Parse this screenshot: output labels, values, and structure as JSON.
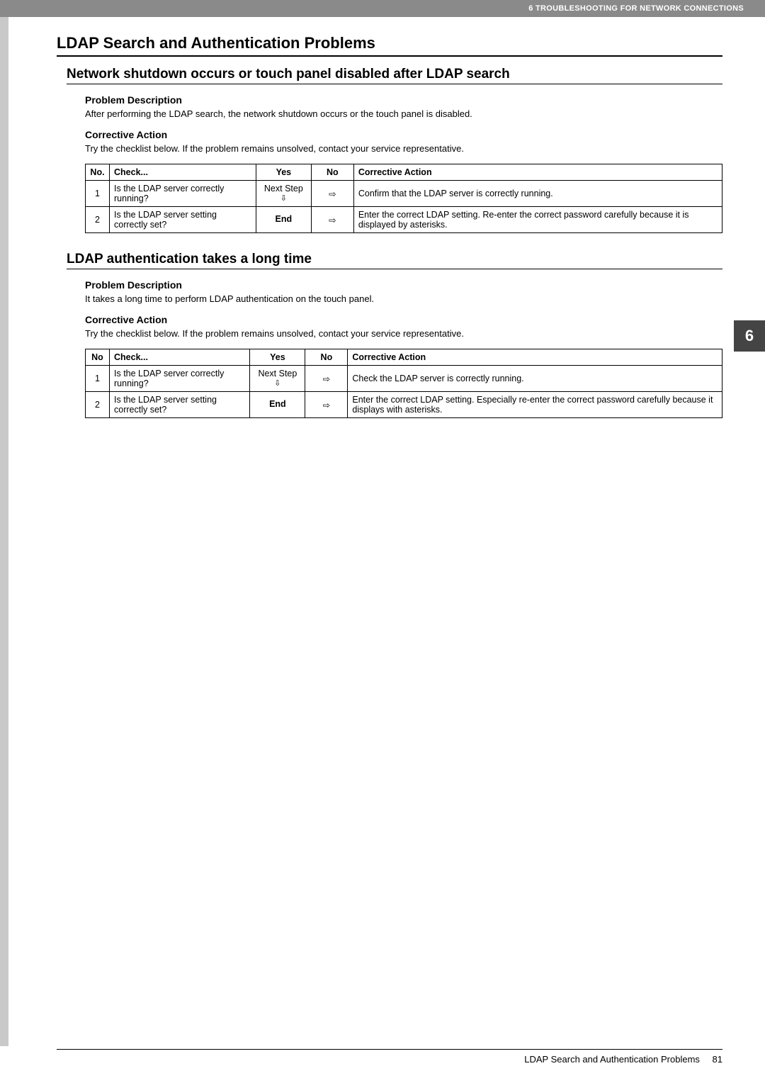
{
  "header": {
    "chapter": "6 TROUBLESHOOTING FOR NETWORK CONNECTIONS"
  },
  "h1": "LDAP Search and Authentication Problems",
  "section1": {
    "title": "Network shutdown occurs or touch panel disabled after LDAP search",
    "problem_h": "Problem Description",
    "problem_t": "After performing the LDAP search, the network shutdown occurs or the touch panel is disabled.",
    "corr_h": "Corrective Action",
    "corr_t": "Try the checklist below. If the problem remains unsolved, contact your service representative.",
    "table": {
      "headers": {
        "no": "No.",
        "check": "Check...",
        "yes": "Yes",
        "noo": "No",
        "action": "Corrective Action"
      },
      "rows": [
        {
          "no": "1",
          "check": "Is the LDAP server correctly running?",
          "yes_top": "Next Step",
          "yes_arrow": "⇩",
          "noo": "⇨",
          "action": "Confirm that the LDAP server is correctly running."
        },
        {
          "no": "2",
          "check": "Is the LDAP server setting correctly set?",
          "yes_top": "End",
          "yes_arrow": "",
          "noo": "⇨",
          "action": "Enter the correct LDAP setting. Re-enter the correct password carefully because it is displayed by asterisks."
        }
      ]
    }
  },
  "section2": {
    "title": "LDAP authentication takes a long time",
    "problem_h": "Problem Description",
    "problem_t": "It takes a long time to perform LDAP authentication on the touch panel.",
    "corr_h": "Corrective Action",
    "corr_t": "Try the checklist below. If the problem remains unsolved, contact your service representative.",
    "table": {
      "headers": {
        "no": "No",
        "check": "Check...",
        "yes": "Yes",
        "noo": "No",
        "action": "Corrective Action"
      },
      "rows": [
        {
          "no": "1",
          "check": "Is the LDAP server correctly running?",
          "yes_top": "Next Step",
          "yes_arrow": "⇩",
          "noo": "⇨",
          "action": "Check the LDAP server is correctly running."
        },
        {
          "no": "2",
          "check": "Is the LDAP server setting correctly set?",
          "yes_top": "End",
          "yes_arrow": "",
          "noo": "⇨",
          "action": "Enter the correct LDAP setting. Especially re-enter the correct password carefully because it displays with asterisks."
        }
      ]
    }
  },
  "side_tab": "6",
  "footer": {
    "label": "LDAP Search and Authentication Problems",
    "page": "81"
  }
}
